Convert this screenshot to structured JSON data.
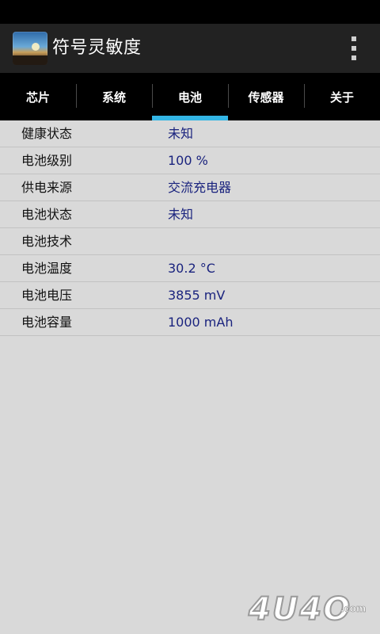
{
  "app": {
    "title": "符号灵敏度",
    "icon": "app-landscape-icon",
    "menu_icon": "overflow-menu-icon"
  },
  "tabs": [
    {
      "label": "芯片",
      "active": false
    },
    {
      "label": "系统",
      "active": false
    },
    {
      "label": "电池",
      "active": true
    },
    {
      "label": "传感器",
      "active": false
    },
    {
      "label": "关于",
      "active": false
    }
  ],
  "battery": {
    "rows": [
      {
        "label": "健康状态",
        "value": "未知"
      },
      {
        "label": "电池级别",
        "value": "100 %"
      },
      {
        "label": "供电来源",
        "value": "交流充电器"
      },
      {
        "label": "电池状态",
        "value": "未知"
      },
      {
        "label": "电池技术",
        "value": ""
      },
      {
        "label": "电池温度",
        "value": "30.2 °C"
      },
      {
        "label": "电池电压",
        "value": "3855 mV"
      },
      {
        "label": "电池容量",
        "value": "1000 mAh"
      }
    ]
  },
  "watermark": {
    "text": "4U4O",
    "suffix": ".com"
  },
  "colors": {
    "accent": "#33b5e5",
    "value_text": "#1a237e",
    "background": "#d9d9d9",
    "action_bar": "#222222"
  }
}
